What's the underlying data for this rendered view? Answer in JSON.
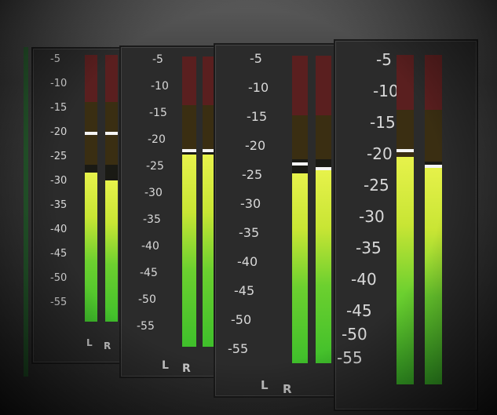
{
  "scale_ticks": [
    "-5",
    "-10",
    "-15",
    "-20",
    "-25",
    "-30",
    "-35",
    "-40",
    "-45",
    "-50",
    "-55"
  ],
  "meters": [
    {
      "left_label": "L",
      "right_label": "R",
      "left_level": 0.62,
      "right_level": 0.58,
      "left_peak": 0.77,
      "right_peak": 0.77
    },
    {
      "left_label": "L",
      "right_label": "R",
      "left_level": 0.78,
      "right_level": 0.78,
      "left_peak": 0.8,
      "right_peak": 0.8
    },
    {
      "left_label": "L",
      "right_label": "R",
      "left_level": 0.75,
      "right_level": 0.78,
      "left_peak": 0.8,
      "right_peak": 0.78
    },
    {
      "left_label": "",
      "right_label": "",
      "left_level": 0.75,
      "right_level": 0.72,
      "left_peak": 0.8,
      "right_peak": 0.78
    }
  ]
}
